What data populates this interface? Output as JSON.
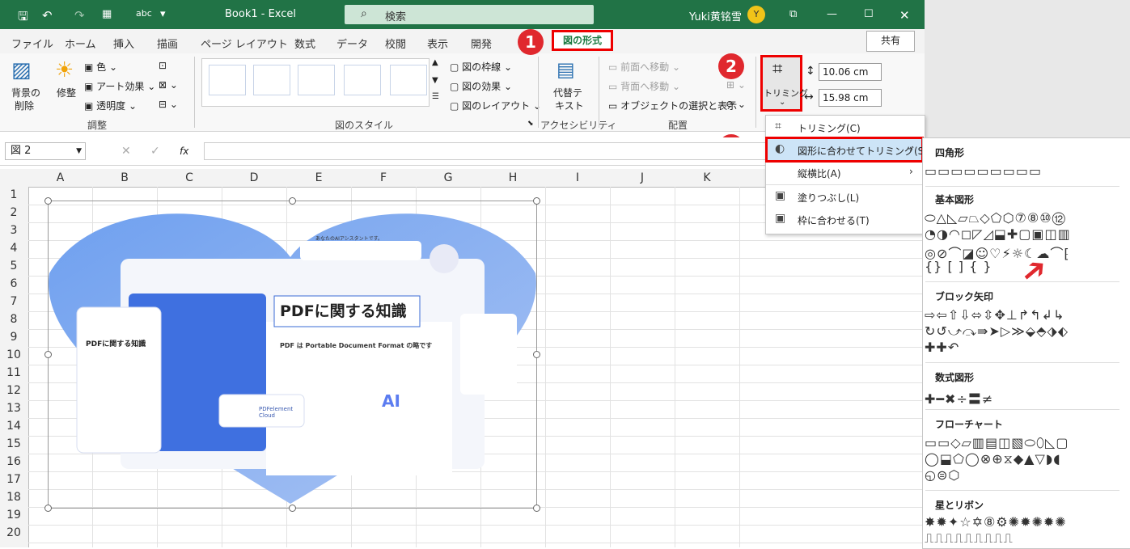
{
  "titlebar": {
    "book": "Book1 - Excel",
    "search": "検索",
    "user": "Yuki黄铭雪",
    "avatar": "Y"
  },
  "tabs": [
    "ファイル",
    "ホーム",
    "挿入",
    "描画",
    "ページ レイアウト",
    "数式",
    "データ",
    "校閲",
    "表示",
    "開発"
  ],
  "active_tab": "図の形式",
  "share": "共有",
  "ribbon": {
    "remove_bg": "背景の削除",
    "remove_bg_1": "背景の",
    "remove_bg_2": "削除",
    "corrections": "修整",
    "color": "色",
    "art_effects": "アート効果",
    "transparency": "透明度",
    "adjust_group": "調整",
    "pic_border": "図の枠線",
    "pic_effects": "図の効果",
    "pic_layout": "図のレイアウト",
    "styles_group": "図のスタイル",
    "alt_text_1": "代替テ",
    "alt_text_2": "キスト",
    "access_group": "アクセシビリティ",
    "bring_forward": "前面へ移動",
    "send_backward": "背面へ移動",
    "selection_pane": "オブジェクトの選択と表示",
    "arrange_group": "配置",
    "crop": "トリミング",
    "height": "10.06 cm",
    "width": "15.98 cm"
  },
  "badges": [
    "1",
    "2",
    "3"
  ],
  "formula": {
    "namebox": "図 2",
    "fx": "fx"
  },
  "columns": [
    "A",
    "B",
    "C",
    "D",
    "E",
    "F",
    "G",
    "H",
    "I",
    "J",
    "K"
  ],
  "rows": [
    "1",
    "2",
    "3",
    "4",
    "5",
    "6",
    "7",
    "8",
    "9",
    "10",
    "11",
    "12",
    "13",
    "14",
    "15",
    "16",
    "17",
    "18",
    "19",
    "20"
  ],
  "crop_menu": {
    "crop": "トリミング(C)",
    "crop_to_shape": "図形に合わせてトリミング(S)",
    "aspect": "縦横比(A)",
    "fill": "塗りつぶし(L)",
    "fit": "枠に合わせる(T)"
  },
  "shapes_panel": {
    "rect": "四角形",
    "basic": "基本図形",
    "block_arrows": "ブロック矢印",
    "equation": "数式図形",
    "flowchart": "フローチャート",
    "stars": "星とリボン"
  },
  "picture": {
    "title": "PDFに関する知識",
    "subtitle": "PDF は Portable Document Format の略です",
    "phone_title": "PDFに関する知識",
    "cloud": "PDFelement Cloud",
    "ai": "AI",
    "chat": "あなたのAIアシスタントです。"
  },
  "colors": {
    "excel_green": "#217346",
    "highlight_red": "#e00000"
  }
}
